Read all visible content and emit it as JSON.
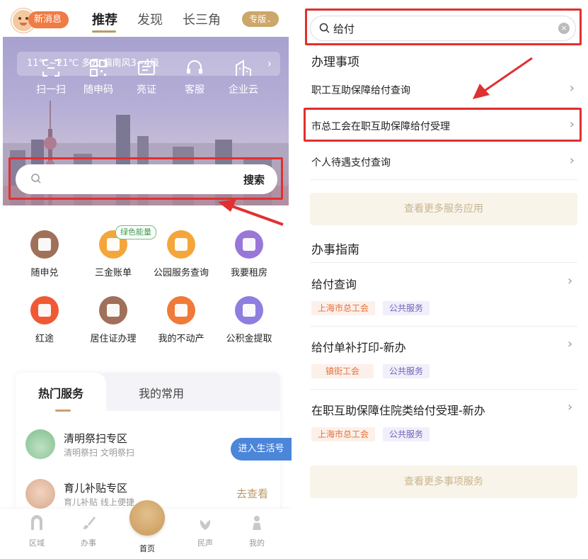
{
  "left": {
    "topbar": {
      "new_msg": "新消息",
      "tabs": [
        "推荐",
        "发现",
        "长三角"
      ],
      "edition": "专版"
    },
    "weather": "11℃~21℃ 多云 偏南风3~4级",
    "quick_actions": [
      {
        "label": "扫一扫",
        "icon": "scan-icon"
      },
      {
        "label": "随申码",
        "icon": "qr-code-icon"
      },
      {
        "label": "亮证",
        "icon": "id-card-icon"
      },
      {
        "label": "客服",
        "icon": "customer-service-icon"
      },
      {
        "label": "企业云",
        "icon": "building-icon"
      }
    ],
    "search": {
      "button": "搜索"
    },
    "services": [
      {
        "label": "随申兑",
        "icon": "redeem-icon",
        "color": "#a0705a"
      },
      {
        "label": "三金账单",
        "icon": "yen-house-icon",
        "color": "#f4a63a"
      },
      {
        "label": "公园服务查询",
        "icon": "park-icon",
        "color": "#f4a63a"
      },
      {
        "label": "我要租房",
        "icon": "house-rent-icon",
        "color": "#9877d9"
      },
      {
        "label": "红途",
        "icon": "star-icon",
        "color": "#ef5a35"
      },
      {
        "label": "居住证办理",
        "icon": "residence-card-icon",
        "color": "#a0705a"
      },
      {
        "label": "我的不动产",
        "icon": "property-icon",
        "color": "#f07a3a"
      },
      {
        "label": "公积金提取",
        "icon": "fund-withdraw-icon",
        "color": "#8f7de0"
      }
    ],
    "green_tag": "绿色能量",
    "hot_card": {
      "tab_hot": "热门服务",
      "tab_fav": "我的常用",
      "items": [
        {
          "title": "清明祭扫专区",
          "sub": "清明祭扫 文明祭扫",
          "action": "进入生活号"
        },
        {
          "title": "育儿补贴专区",
          "sub": "育儿补贴 线上便捷",
          "action": "去查看"
        }
      ]
    },
    "bottom_nav": [
      "区域",
      "办事",
      "首页",
      "民声",
      "我的"
    ]
  },
  "right": {
    "search_value": "给付",
    "section_items_title": "办理事项",
    "items": [
      "职工互助保障给付查询",
      "市总工会在职互助保障给付受理",
      "个人待遇支付查询"
    ],
    "more_services": "查看更多服务应用",
    "section_guide_title": "办事指南",
    "guides": [
      {
        "title": "给付查询",
        "tags": [
          "上海市总工会",
          "公共服务"
        ]
      },
      {
        "title": "给付单补打印-新办",
        "tags": [
          "镇街工会",
          "公共服务"
        ]
      },
      {
        "title": "在职互助保障住院类给付受理-新办",
        "tags": [
          "上海市总工会",
          "公共服务"
        ]
      }
    ],
    "more_items": "查看更多事项服务"
  },
  "colors": {
    "highlight": "#e03030",
    "accent": "#c9a26a",
    "primary_blue": "#4b86d9"
  }
}
